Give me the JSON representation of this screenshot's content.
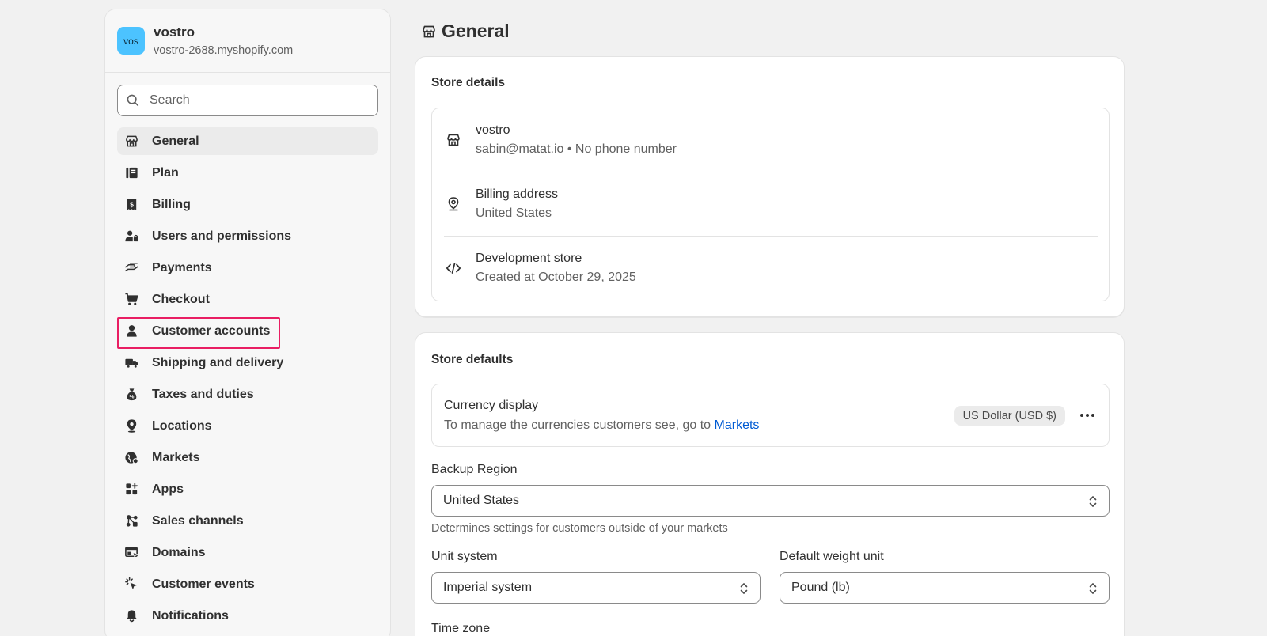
{
  "store": {
    "avatar": "vos",
    "name": "vostro",
    "domain": "vostro-2688.myshopify.com"
  },
  "search": {
    "placeholder": "Search"
  },
  "nav": [
    {
      "label": "General",
      "icon": "store-icon",
      "active": true
    },
    {
      "label": "Plan",
      "icon": "plan-icon"
    },
    {
      "label": "Billing",
      "icon": "billing-icon"
    },
    {
      "label": "Users and permissions",
      "icon": "users-icon"
    },
    {
      "label": "Payments",
      "icon": "payments-icon"
    },
    {
      "label": "Checkout",
      "icon": "cart-icon"
    },
    {
      "label": "Customer accounts",
      "icon": "person-icon",
      "highlighted": true
    },
    {
      "label": "Shipping and delivery",
      "icon": "truck-icon"
    },
    {
      "label": "Taxes and duties",
      "icon": "tax-bag-icon"
    },
    {
      "label": "Locations",
      "icon": "location-pin-icon"
    },
    {
      "label": "Markets",
      "icon": "globe-icon"
    },
    {
      "label": "Apps",
      "icon": "apps-icon"
    },
    {
      "label": "Sales channels",
      "icon": "sales-channels-icon"
    },
    {
      "label": "Domains",
      "icon": "domains-icon"
    },
    {
      "label": "Customer events",
      "icon": "cursor-click-icon"
    },
    {
      "label": "Notifications",
      "icon": "bell-icon"
    }
  ],
  "page": {
    "title": "General"
  },
  "store_details": {
    "title": "Store details",
    "rows": [
      {
        "main": "vostro",
        "sub": "sabin@matat.io • No phone number",
        "icon": "store-icon"
      },
      {
        "main": "Billing address",
        "sub": "United States",
        "icon": "location-pin-icon"
      },
      {
        "main": "Development store",
        "sub": "Created at October 29, 2025",
        "icon": "code-icon"
      }
    ]
  },
  "store_defaults": {
    "title": "Store defaults",
    "currency": {
      "title": "Currency display",
      "sub_prefix": "To manage the currencies customers see, go to ",
      "link": "Markets",
      "badge": "US Dollar (USD $)"
    },
    "backup_region": {
      "label": "Backup Region",
      "value": "United States",
      "help": "Determines settings for customers outside of your markets"
    },
    "unit_system": {
      "label": "Unit system",
      "value": "Imperial system"
    },
    "weight_unit": {
      "label": "Default weight unit",
      "value": "Pound (lb)"
    },
    "time_zone": {
      "label": "Time zone"
    }
  },
  "colors": {
    "highlight": "#e91e63",
    "avatar": "#4cc3ff",
    "link": "#005bd3"
  }
}
